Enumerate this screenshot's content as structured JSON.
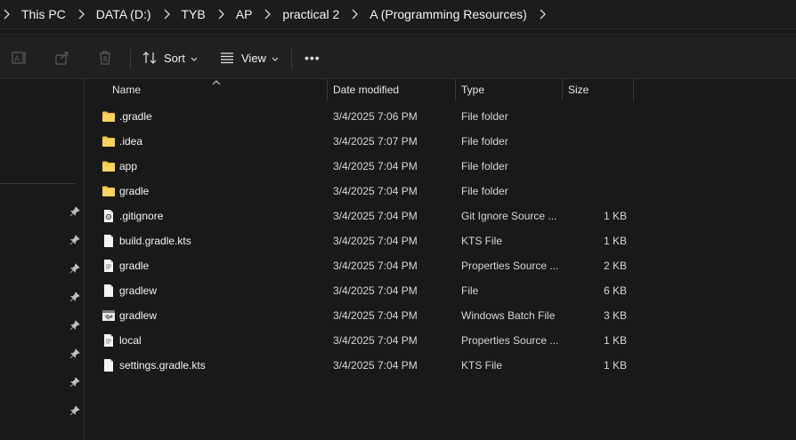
{
  "breadcrumb": {
    "items": [
      "This PC",
      "DATA (D:)",
      "TYB",
      "AP",
      "practical 2",
      "A (Programming Resources)"
    ]
  },
  "toolbar": {
    "sort_label": "Sort",
    "view_label": "View",
    "more_label": "•••"
  },
  "columns": {
    "name": "Name",
    "date": "Date modified",
    "type": "Type",
    "size": "Size"
  },
  "files": [
    {
      "name": ".gradle",
      "date": "3/4/2025 7:06 PM",
      "type": "File folder",
      "size": "",
      "icon": "folder-icon"
    },
    {
      "name": ".idea",
      "date": "3/4/2025 7:07 PM",
      "type": "File folder",
      "size": "",
      "icon": "folder-icon"
    },
    {
      "name": "app",
      "date": "3/4/2025 7:04 PM",
      "type": "File folder",
      "size": "",
      "icon": "folder-icon"
    },
    {
      "name": "gradle",
      "date": "3/4/2025 7:04 PM",
      "type": "File folder",
      "size": "",
      "icon": "folder-icon"
    },
    {
      "name": ".gitignore",
      "date": "3/4/2025 7:04 PM",
      "type": "Git Ignore Source ...",
      "size": "1 KB",
      "icon": "settings-file-icon"
    },
    {
      "name": "build.gradle.kts",
      "date": "3/4/2025 7:04 PM",
      "type": "KTS File",
      "size": "1 KB",
      "icon": "file-icon"
    },
    {
      "name": "gradle",
      "date": "3/4/2025 7:04 PM",
      "type": "Properties Source ...",
      "size": "2 KB",
      "icon": "text-file-icon"
    },
    {
      "name": "gradlew",
      "date": "3/4/2025 7:04 PM",
      "type": "File",
      "size": "6 KB",
      "icon": "file-icon"
    },
    {
      "name": "gradlew",
      "date": "3/4/2025 7:04 PM",
      "type": "Windows Batch File",
      "size": "3 KB",
      "icon": "batch-file-icon"
    },
    {
      "name": "local",
      "date": "3/4/2025 7:04 PM",
      "type": "Properties Source ...",
      "size": "1 KB",
      "icon": "text-file-icon"
    },
    {
      "name": "settings.gradle.kts",
      "date": "3/4/2025 7:04 PM",
      "type": "KTS File",
      "size": "1 KB",
      "icon": "file-icon"
    }
  ],
  "colors": {
    "folder": "#f8c440",
    "background": "#191919",
    "text": "#ffffff"
  }
}
